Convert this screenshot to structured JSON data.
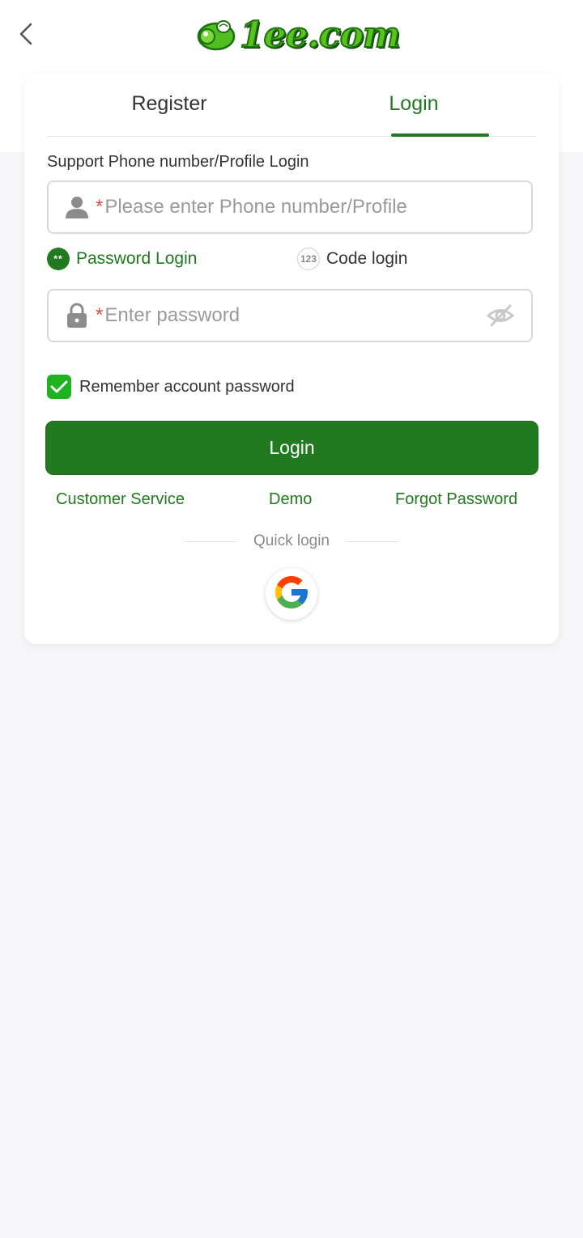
{
  "header": {
    "back_icon": "chevron-left-icon",
    "logo_text": "1ee.com"
  },
  "tabs": [
    {
      "label": "Register",
      "active": false
    },
    {
      "label": "Login",
      "active": true
    }
  ],
  "form": {
    "support_label": "Support Phone number/Profile Login",
    "account": {
      "required_mark": "*",
      "placeholder": "Please enter Phone number/Profile",
      "value": "",
      "icon": "user-icon"
    },
    "modes": {
      "password": {
        "label": "Password Login",
        "badge": "**",
        "selected": true
      },
      "code": {
        "label": "Code login",
        "badge": "123",
        "selected": false
      }
    },
    "password": {
      "required_mark": "*",
      "placeholder": "Enter password",
      "value": "",
      "icon": "lock-icon",
      "toggle_icon": "eye-off-icon"
    },
    "remember": {
      "label": "Remember account password",
      "checked": true
    },
    "submit_label": "Login"
  },
  "links": {
    "customer_service": "Customer Service",
    "demo": "Demo",
    "forgot_password": "Forgot Password"
  },
  "quick_login": {
    "label": "Quick login",
    "providers": [
      "google-icon"
    ]
  },
  "colors": {
    "brand_green": "#217a1f",
    "checkbox_green": "#1fb21f",
    "required_red": "#e24a3b",
    "page_bg": "#f6f6f8"
  }
}
